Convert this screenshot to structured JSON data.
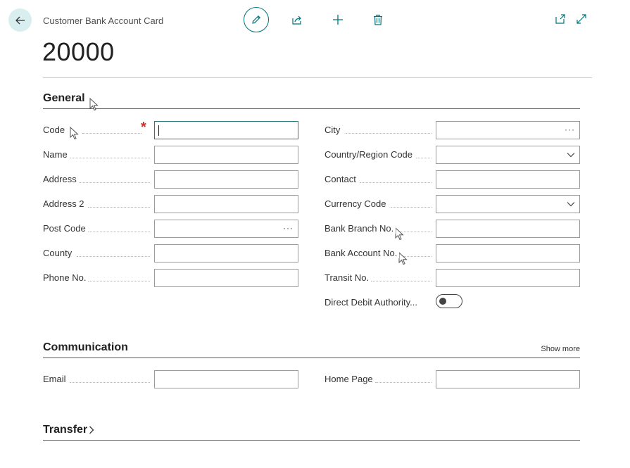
{
  "header": {
    "breadcrumb": "Customer Bank Account Card",
    "title": "20000",
    "toolbar": {
      "edit_icon": "pencil-icon",
      "share_icon": "share-icon",
      "new_icon": "plus-icon",
      "delete_icon": "trash-icon",
      "open_new_window_icon": "open-in-new-window-icon",
      "expand_icon": "expand-icon"
    }
  },
  "general": {
    "title": "General",
    "left": [
      {
        "label": "Code",
        "value": "",
        "required": true,
        "focused": true
      },
      {
        "label": "Name",
        "value": ""
      },
      {
        "label": "Address",
        "value": ""
      },
      {
        "label": "Address 2",
        "value": ""
      },
      {
        "label": "Post Code",
        "value": "",
        "lookup": true
      },
      {
        "label": "County",
        "value": ""
      },
      {
        "label": "Phone No.",
        "value": ""
      }
    ],
    "right": [
      {
        "label": "City",
        "value": "",
        "lookup": true
      },
      {
        "label": "Country/Region Code",
        "value": "",
        "dropdown": true
      },
      {
        "label": "Contact",
        "value": ""
      },
      {
        "label": "Currency Code",
        "value": "",
        "dropdown": true
      },
      {
        "label": "Bank Branch No.",
        "value": ""
      },
      {
        "label": "Bank Account No.",
        "value": ""
      },
      {
        "label": "Transit No.",
        "value": ""
      },
      {
        "label": "Direct Debit Authority...",
        "value": "off",
        "toggle": true
      }
    ],
    "required_mark": "*",
    "lookup_glyph": "···"
  },
  "communication": {
    "title": "Communication",
    "show_more": "Show more",
    "left": [
      {
        "label": "Email",
        "value": ""
      }
    ],
    "right": [
      {
        "label": "Home Page",
        "value": ""
      }
    ]
  },
  "transfer": {
    "title": "Transfer"
  },
  "colors": {
    "accent": "#00747a",
    "required": "#d32f2f",
    "back_button_bg": "#d9eeee"
  }
}
